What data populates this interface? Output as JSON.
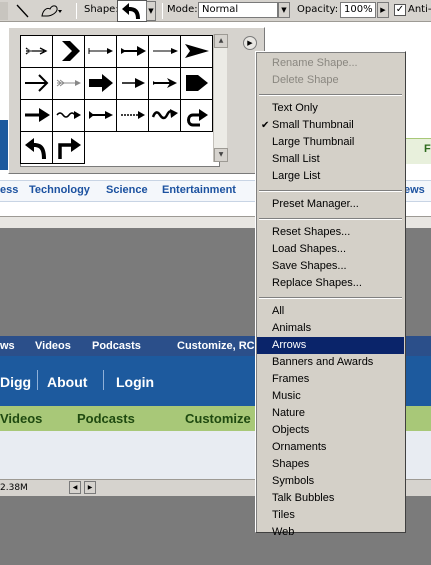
{
  "options_bar": {
    "shape_label": "Shape:",
    "mode_label": "Mode:",
    "mode_value": "Normal",
    "opacity_label": "Opacity:",
    "opacity_value": "100%",
    "antialias_label": "Anti-"
  },
  "shape_grid": {
    "icons": [
      "dart-arrow-icon",
      "chevron-arrow-icon",
      "thin-arrow-icon",
      "bold-tail-arrow-icon",
      "line-arrow-icon",
      "triangle-arrow-icon",
      "open-arrow-icon",
      "feather-arrow-icon",
      "block-arrow-icon",
      "short-arrow-icon",
      "notched-arrow-icon",
      "pentagon-arrow-icon",
      "heavy-arrow-icon",
      "wavy-arrow-icon",
      "tailed-arrow-icon",
      "dotted-arrow-icon",
      "squiggle-arrow-icon",
      "curved-hook-arrow-icon",
      "curve-up-left-arrow-icon",
      "turn-right-arrow-icon"
    ]
  },
  "background": {
    "nav_top": [
      "ess",
      "Technology",
      "Science",
      "Entertainment",
      "ews"
    ],
    "nav_dark": [
      "ws",
      "Videos",
      "Podcasts",
      "Customize, RC"
    ],
    "nav_blue": [
      "Digg",
      "About",
      "Login"
    ],
    "nav_green": [
      "Videos",
      "Podcasts",
      "Customize"
    ],
    "status_size": "2.38M",
    "green_letter": "F"
  },
  "menu": {
    "groups": [
      [
        {
          "label": "Rename Shape...",
          "disabled": true
        },
        {
          "label": "Delete Shape",
          "disabled": true
        }
      ],
      [
        {
          "label": "Text Only"
        },
        {
          "label": "Small Thumbnail",
          "checked": true
        },
        {
          "label": "Large Thumbnail"
        },
        {
          "label": "Small List"
        },
        {
          "label": "Large List"
        }
      ],
      [
        {
          "label": "Preset Manager..."
        }
      ],
      [
        {
          "label": "Reset Shapes..."
        },
        {
          "label": "Load Shapes..."
        },
        {
          "label": "Save Shapes..."
        },
        {
          "label": "Replace Shapes..."
        }
      ],
      [
        {
          "label": "All"
        },
        {
          "label": "Animals"
        },
        {
          "label": "Arrows",
          "selected": true
        },
        {
          "label": "Banners and Awards"
        },
        {
          "label": "Frames"
        },
        {
          "label": "Music"
        },
        {
          "label": "Nature"
        },
        {
          "label": "Objects"
        },
        {
          "label": "Ornaments"
        },
        {
          "label": "Shapes"
        },
        {
          "label": "Symbols"
        },
        {
          "label": "Talk Bubbles"
        },
        {
          "label": "Tiles"
        },
        {
          "label": "Web"
        }
      ]
    ]
  },
  "colors": {
    "menu_highlight": "#0a246a",
    "digg_blue": "#1d5a9e",
    "digg_green": "#a8c878",
    "nav_dark": "#2b4f8a"
  }
}
